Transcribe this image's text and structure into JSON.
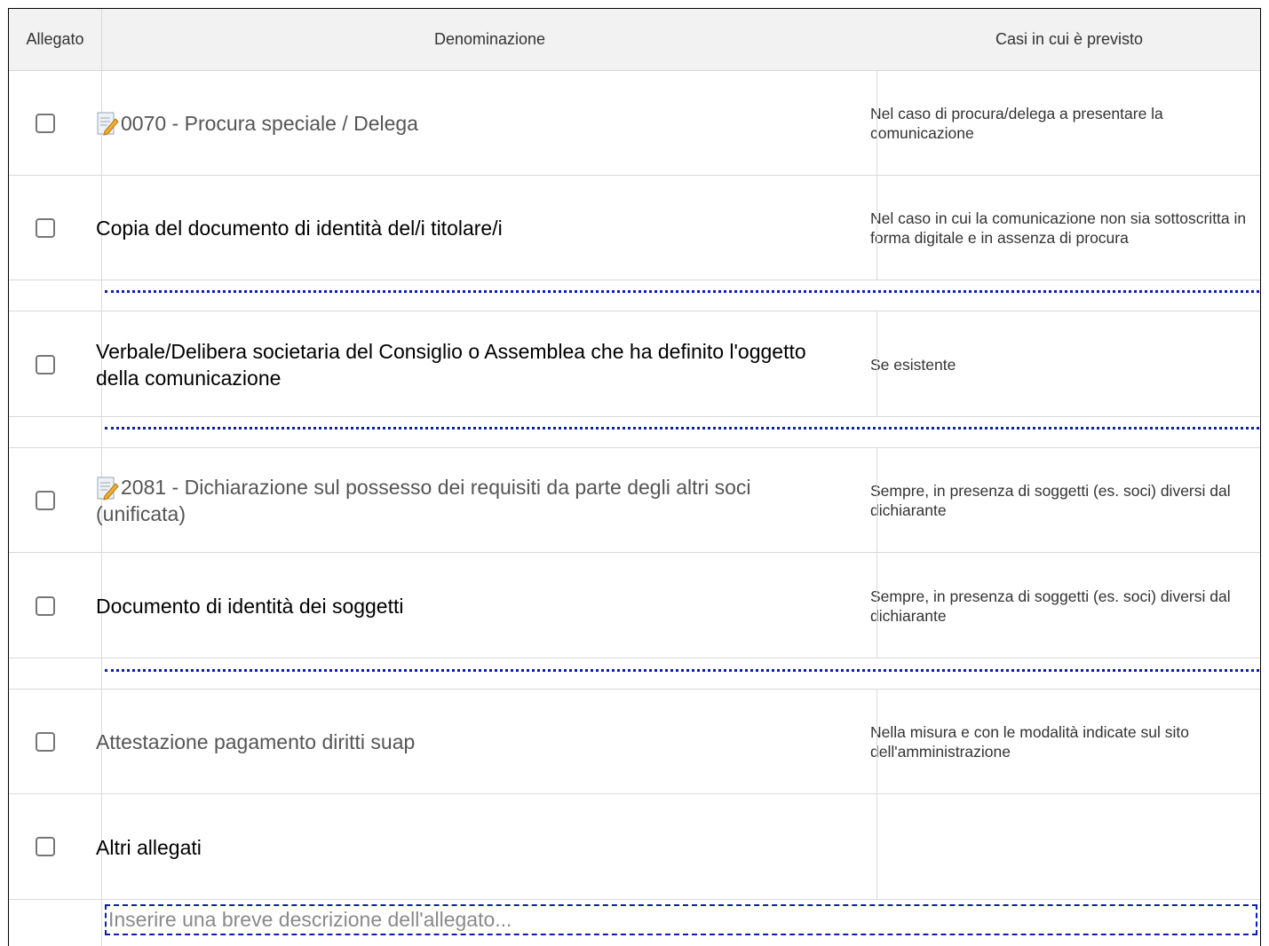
{
  "table": {
    "headers": {
      "attached": "Allegato",
      "name": "Denominazione",
      "cases": "Casi in cui è previsto"
    },
    "rows": [
      {
        "name": "0070 - Procura speciale / Delega",
        "has_form_icon": true,
        "cases": "Nel caso di procura/delega a presentare la comunicazione",
        "checked": false
      },
      {
        "name": "Copia del documento di identità del/i titolare/i",
        "has_form_icon": false,
        "cases": "Nel caso in cui la comunicazione non sia sottoscritta in forma digitale e in assenza di procura",
        "checked": false
      },
      {
        "name": "Verbale/Delibera societaria del Consiglio o Assemblea che ha definito l'oggetto della comunicazione",
        "has_form_icon": false,
        "cases": "Se esistente",
        "checked": false
      },
      {
        "name": "2081 - Dichiarazione sul possesso dei requisiti da parte degli altri soci (unificata)",
        "has_form_icon": true,
        "cases": "Sempre, in presenza di soggetti (es. soci) diversi dal dichiarante",
        "checked": false
      },
      {
        "name": "Documento di identità dei soggetti",
        "has_form_icon": false,
        "cases": "Sempre, in presenza di soggetti (es. soci) diversi dal dichiarante",
        "checked": false
      },
      {
        "name": "Attestazione pagamento diritti suap",
        "has_form_icon": false,
        "cases": "Nella misura e con le modalità indicate sul sito dell'amministrazione",
        "checked": false
      },
      {
        "name": "Altri allegati",
        "has_form_icon": false,
        "cases": "",
        "checked": false
      }
    ],
    "description_input": {
      "placeholder": "Inserire una breve descrizione dell'allegato...",
      "value": ""
    }
  },
  "colors": {
    "header_bg": "#f2f2f2",
    "grid_line": "#d9d9d9",
    "separator_dash": "#0b1fa8",
    "input_border": "#0b1fa8",
    "checkbox_border": "#767676"
  },
  "icons": {
    "form_icon": "edit-document-icon"
  }
}
